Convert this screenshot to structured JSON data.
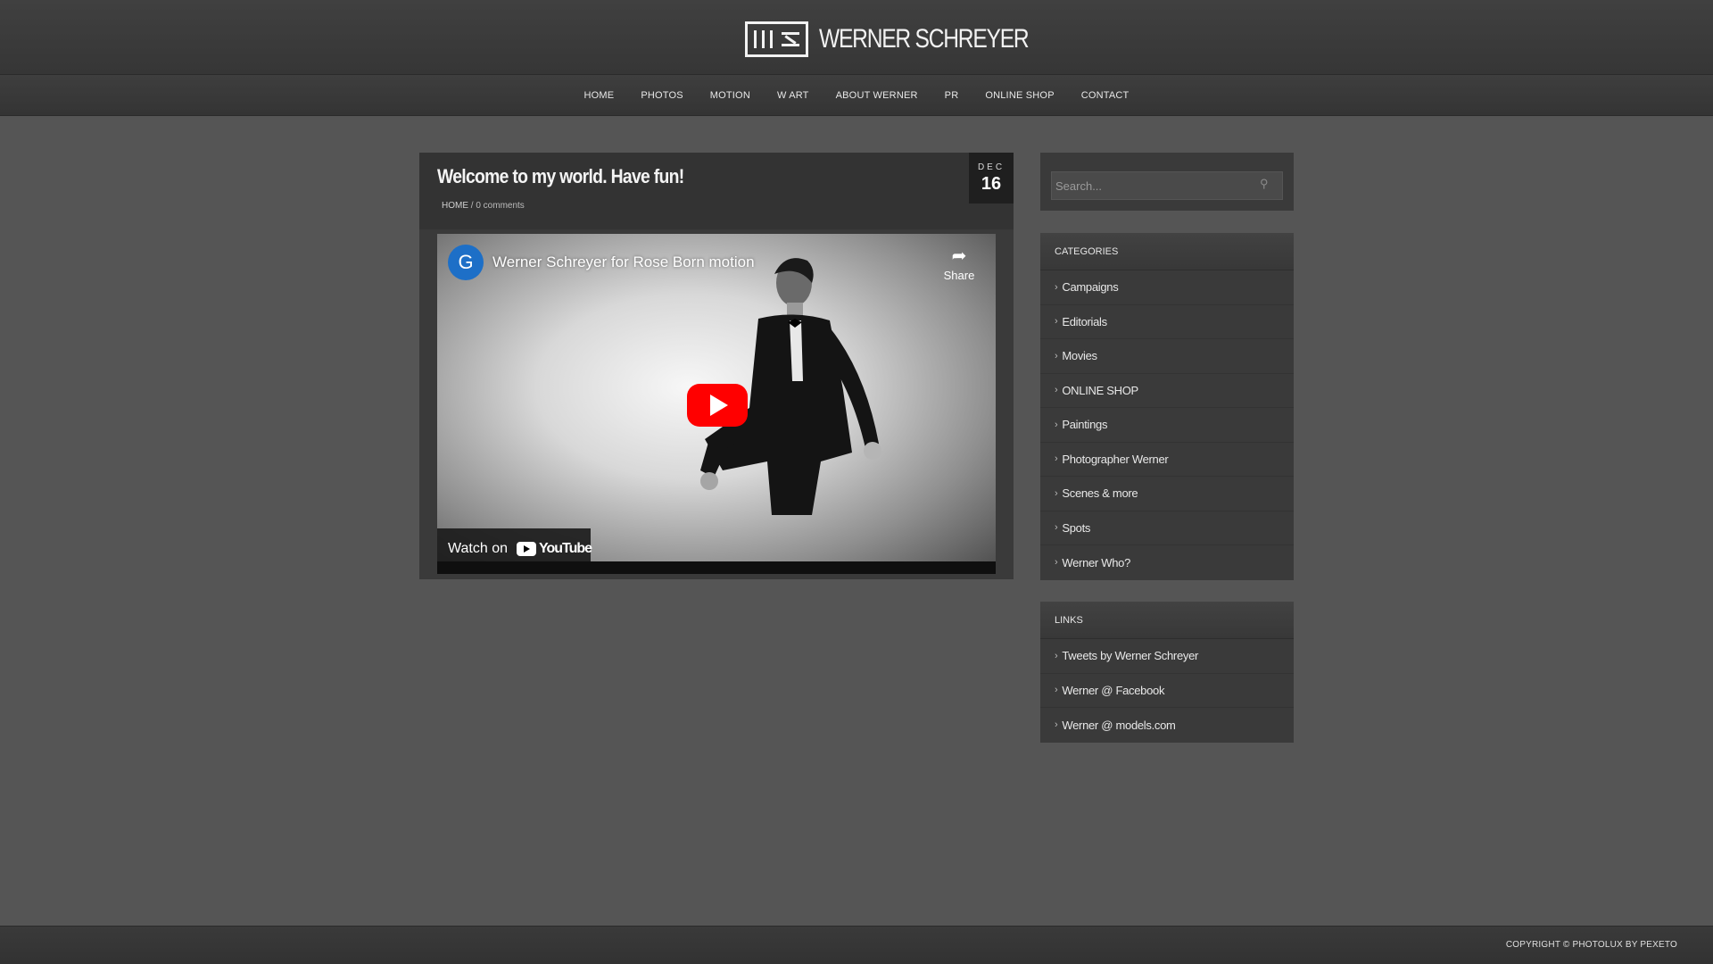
{
  "site": {
    "logo_text": "WERNER SCHREYER"
  },
  "nav": {
    "items": [
      "HOME",
      "PHOTOS",
      "MOTION",
      "W ART",
      "ABOUT WERNER",
      "PR",
      "ONLINE SHOP",
      "CONTACT"
    ]
  },
  "post": {
    "title": "Welcome to my world. Have fun!",
    "breadcrumb_home": "HOME",
    "breadcrumb_sep": " / ",
    "comments": "0 comments",
    "date_month": "DEC",
    "date_day": "16"
  },
  "video": {
    "channel_initial": "G",
    "title": "Werner Schreyer for Rose Born motion",
    "share_label": "Share",
    "watch_on_label": "Watch on",
    "youtube_text": "YouTube",
    "brand_color": "#ff0000"
  },
  "search": {
    "placeholder": "Search..."
  },
  "categories": {
    "title": "CATEGORIES",
    "items": [
      "Campaigns",
      "Editorials",
      "Movies",
      "ONLINE SHOP",
      "Paintings",
      "Photographer Werner",
      "Scenes & more",
      "Spots",
      "Werner Who?"
    ]
  },
  "links": {
    "title": "LINKS",
    "items": [
      "Tweets by Werner Schreyer",
      "Werner @ Facebook",
      "Werner @ models.com"
    ]
  },
  "footer": {
    "copyright": "COPYRIGHT © PHOTOLUX BY PEXETO"
  }
}
